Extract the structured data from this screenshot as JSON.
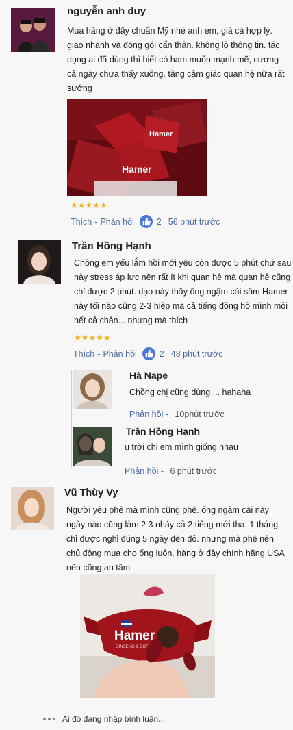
{
  "comments": [
    {
      "name": "nguyễn anh duy",
      "text": "Mua hàng ở đây chuẩn Mỹ nhé anh em, giá cả hợp lý. giao nhanh và đóng gói cẩn thận. không lộ thông tin. tác dụng ai đã dùng thì biết có ham muốn mạnh mẽ, cương cả ngày chưa thấy xuống. tăng cảm giác quan hệ nữa rất sướng",
      "rating": "★★★★★",
      "like_label": "Thích",
      "reply_label": "Phản hồi",
      "separator": " - ",
      "likes": "2",
      "time": "56 phút trước",
      "photo_text": "Hamer"
    },
    {
      "name": "Trần Hồng Hạnh",
      "text": "Chồng em yếu lắm hồi mới yêu còn được 5 phút chứ sau này stress áp lực nên rất ít khi quan hệ mà quan hệ cũng chỉ được 2 phút. dạo này thấy ông ngậm cái sâm Hamer này tối nào cũng 2-3 hiệp mà cả tiếng đồng hồ mình mỏi hết cả chân... nhưng mà thích",
      "rating": "★★★★★",
      "like_label": "Thích",
      "reply_label": "Phản hồi",
      "separator": " - ",
      "likes": "2",
      "time": "48 phút trước",
      "replies": [
        {
          "name": "Hà Nape",
          "text": "Chồng chị cũng dùng ... hahaha",
          "reply_label": "Phản hồi",
          "separator": " - ",
          "time": "10phút trước"
        },
        {
          "name": "Trần Hồng Hạnh",
          "text": "u trời chị em mình giống nhau",
          "reply_label": "Phản hồi",
          "separator": " - ",
          "time": "6 phút trước"
        }
      ]
    },
    {
      "name": "Vũ Thùy Vy",
      "text": "Người yêu phê mà mình cũng phê. ống ngậm cái này ngày nào cũng làm 2 3 nháy cả 2 tiếng mới tha. 1 tháng chỉ được nghỉ đúng 5 ngày đèn đỏ. nhưng mà phê nên chủ động mua cho ổng luôn. hàng ở đây chính hãng USA nên cũng an tâm",
      "photo_text": "Hamer",
      "photo_subtext": "GINSENG & COFFEE"
    }
  ],
  "typing_text": "Ai đó đang nhập bình luận...",
  "colors": {
    "link": "#4b6aa0",
    "star": "#f3b11b",
    "like_badge": "#4a76d4",
    "candy_red": "#a1141c"
  },
  "icons": {
    "like": "thumbs-up-icon",
    "typing": "typing-dots-icon"
  }
}
